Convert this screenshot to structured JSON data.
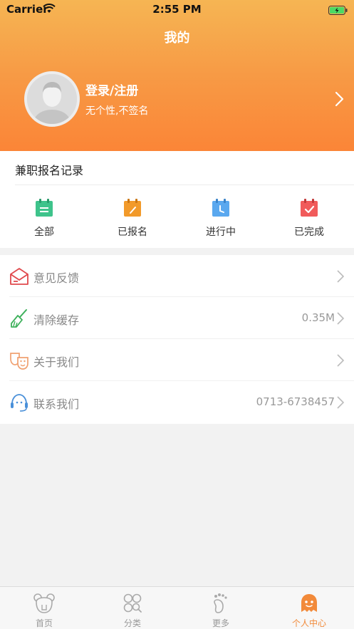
{
  "status_bar": {
    "carrier": "Carrier",
    "time": "2:55 PM"
  },
  "header": {
    "title": "我的",
    "user_name": "登录/注册",
    "user_sign": "无个性,不签名"
  },
  "records": {
    "title": "兼职报名记录",
    "items": [
      {
        "label": "全部",
        "icon": "calendar-list-icon",
        "color": "#3ec38b"
      },
      {
        "label": "已报名",
        "icon": "calendar-edit-icon",
        "color": "#f29a2a"
      },
      {
        "label": "进行中",
        "icon": "calendar-clock-icon",
        "color": "#5aa8ef"
      },
      {
        "label": "已完成",
        "icon": "calendar-check-icon",
        "color": "#f15b5b"
      }
    ]
  },
  "menu": [
    {
      "label": "意见反馈",
      "value": "",
      "icon": "feedback-envelope-icon"
    },
    {
      "label": "清除缓存",
      "value": "0.35M",
      "icon": "broom-icon"
    },
    {
      "label": "关于我们",
      "value": "",
      "icon": "masks-icon"
    },
    {
      "label": "联系我们",
      "value": "0713-6738457",
      "icon": "headset-icon"
    }
  ],
  "tabbar": [
    {
      "label": "首页",
      "icon": "home-bear-icon",
      "active": false
    },
    {
      "label": "分类",
      "icon": "category-icon",
      "active": false
    },
    {
      "label": "更多",
      "icon": "footprint-icon",
      "active": false
    },
    {
      "label": "个人中心",
      "icon": "profile-ghost-icon",
      "active": true
    }
  ],
  "colors": {
    "header_top": "#f6b553",
    "header_bottom": "#fb8537",
    "active_tab": "#f28a3a"
  }
}
